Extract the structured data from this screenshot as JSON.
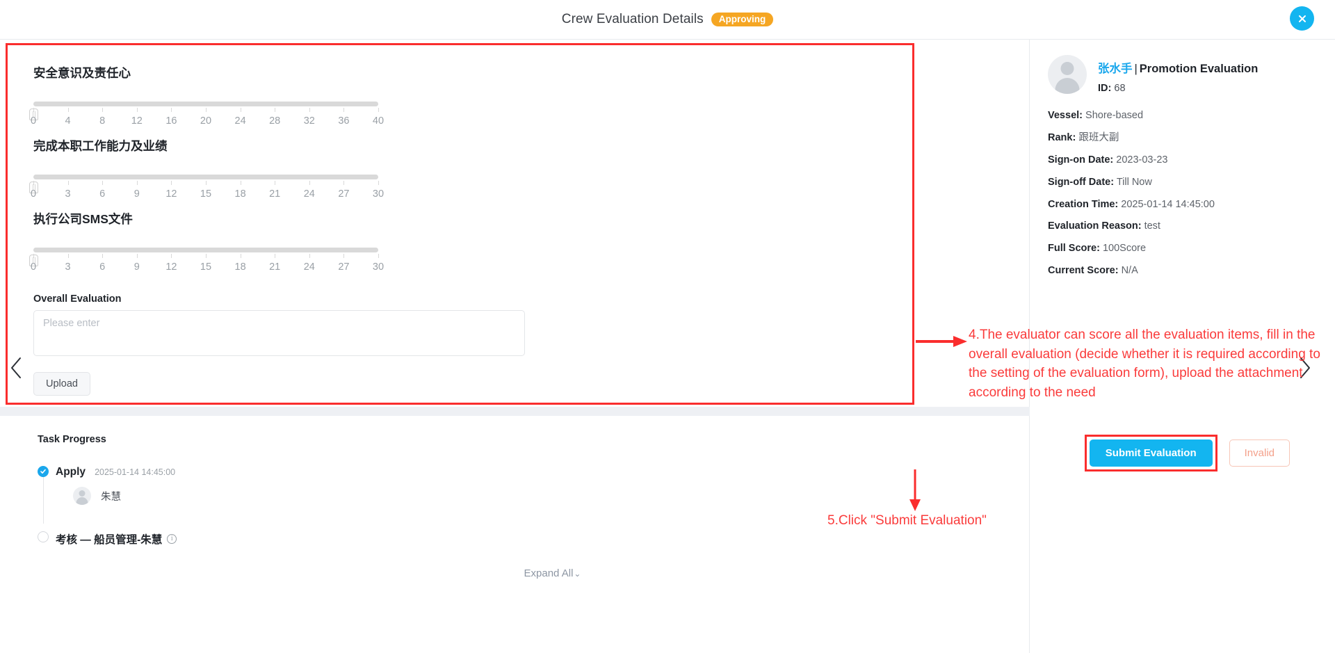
{
  "header": {
    "title": "Crew Evaluation Details",
    "status_badge": "Approving",
    "close_icon": "close-icon"
  },
  "form": {
    "fields": [
      {
        "title": "安全意识及责任心",
        "slider": {
          "value": 0,
          "min": 0,
          "max": 40,
          "step": 4,
          "ticks": [
            "0",
            "4",
            "8",
            "12",
            "16",
            "20",
            "24",
            "28",
            "32",
            "36",
            "40"
          ]
        }
      },
      {
        "title": "完成本职工作能力及业绩",
        "slider": {
          "value": 0,
          "min": 0,
          "max": 30,
          "step": 3,
          "ticks": [
            "0",
            "3",
            "6",
            "9",
            "12",
            "15",
            "18",
            "21",
            "24",
            "27",
            "30"
          ]
        }
      },
      {
        "title": "执行公司SMS文件",
        "slider": {
          "value": 0,
          "min": 0,
          "max": 30,
          "step": 3,
          "ticks": [
            "0",
            "3",
            "6",
            "9",
            "12",
            "15",
            "18",
            "21",
            "24",
            "27",
            "30"
          ]
        }
      }
    ],
    "overall_label": "Overall Evaluation",
    "overall_value": "",
    "overall_placeholder": "Please enter",
    "upload_label": "Upload"
  },
  "nav": {
    "prev_icon": "chevron-left-icon",
    "next_icon": "chevron-right-icon"
  },
  "progress": {
    "title": "Task Progress",
    "items": [
      {
        "name": "Apply",
        "time": "2025-01-14 14:45:00",
        "person": "朱慧",
        "state": "done"
      },
      {
        "name": "考核 — 船员管理-朱慧",
        "time": "",
        "person": "",
        "state": "pending",
        "info_icon": "info-icon"
      }
    ],
    "expand_all": "Expand All",
    "expand_chevron": "⌄"
  },
  "actions": {
    "submit_label": "Submit Evaluation",
    "invalid_label": "Invalid"
  },
  "sidebar": {
    "person_name": "张水手",
    "separator": "|",
    "evaluation_type": "Promotion Evaluation",
    "id_key": "ID:",
    "id_value": "68",
    "details": [
      {
        "key": "Vessel:",
        "value": "Shore-based"
      },
      {
        "key": "Rank:",
        "value": "跟班大副"
      },
      {
        "key": "Sign-on Date:",
        "value": "2023-03-23"
      },
      {
        "key": "Sign-off Date:",
        "value": "Till Now"
      },
      {
        "key": "Creation Time:",
        "value": "2025-01-14 14:45:00"
      },
      {
        "key": "Evaluation Reason:",
        "value": "  test"
      },
      {
        "key": "Full Score:",
        "value": "100Score"
      },
      {
        "key": "Current Score:",
        "value": "N/A"
      }
    ]
  },
  "annotations": {
    "step4": "4.The evaluator can score all the evaluation items, fill in the overall evaluation (decide whether it is required according to the setting of the evaluation form), upload the attachment according to the need",
    "step5": "5.Click \"Submit Evaluation\""
  },
  "colors": {
    "accent": "#13b5f0",
    "badge": "#f5a623",
    "annotation": "#fa3b3b",
    "highlight_border": "#fa2d2d"
  }
}
